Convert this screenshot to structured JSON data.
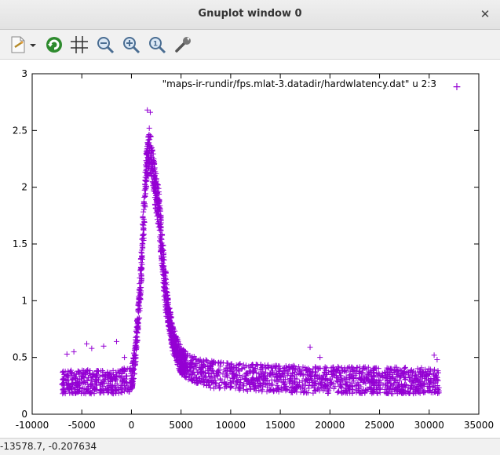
{
  "window": {
    "title": "Gnuplot window 0",
    "close_glyph": "✕"
  },
  "toolbar": {
    "items": [
      {
        "name": "export-icon",
        "tooltip": ""
      },
      {
        "name": "dropdown-arrow-icon",
        "tooltip": ""
      },
      {
        "name": "replot-icon",
        "tooltip": ""
      },
      {
        "name": "grid-icon",
        "tooltip": ""
      },
      {
        "name": "zoom-out-icon",
        "tooltip": ""
      },
      {
        "name": "zoom-in-icon",
        "tooltip": ""
      },
      {
        "name": "zoom-reset-icon",
        "tooltip": ""
      },
      {
        "name": "settings-wrench-icon",
        "tooltip": ""
      }
    ]
  },
  "status": {
    "coords": "-13578.7, -0.207634"
  },
  "colors": {
    "series": "#9400d3",
    "axis": "#000000"
  },
  "chart_data": {
    "type": "scatter",
    "title": "",
    "xlabel": "",
    "ylabel": "",
    "xlim": [
      -10000,
      35000
    ],
    "ylim": [
      0,
      3
    ],
    "x_ticks": [
      "-10000",
      "-5000",
      "0",
      "5000",
      "10000",
      "15000",
      "20000",
      "25000",
      "30000",
      "35000"
    ],
    "y_ticks": [
      "0",
      "0.5",
      "1",
      "1.5",
      "2",
      "2.5",
      "3"
    ],
    "x_tick_values": [
      -10000,
      -5000,
      0,
      5000,
      10000,
      15000,
      20000,
      25000,
      30000,
      35000
    ],
    "y_tick_values": [
      0,
      0.5,
      1,
      1.5,
      2,
      2.5,
      3
    ],
    "grid": false,
    "legend_position": "top-right",
    "series": [
      {
        "name": "\"maps-ir-rundir/fps.mlat-3.datadir/hardwlatency.dat\" u 2:3",
        "marker": "+",
        "x_range": [
          -7000,
          31000
        ],
        "profile": [
          [
            -7000,
            0.27
          ],
          [
            -5000,
            0.27
          ],
          [
            -2000,
            0.27
          ],
          [
            0,
            0.3
          ],
          [
            300,
            0.45
          ],
          [
            600,
            0.75
          ],
          [
            900,
            1.15
          ],
          [
            1200,
            1.65
          ],
          [
            1500,
            2.15
          ],
          [
            1800,
            2.35
          ],
          [
            2100,
            2.2
          ],
          [
            2400,
            2.0
          ],
          [
            2700,
            1.85
          ],
          [
            3000,
            1.55
          ],
          [
            3300,
            1.2
          ],
          [
            3700,
            0.9
          ],
          [
            4200,
            0.65
          ],
          [
            5000,
            0.47
          ],
          [
            6000,
            0.4
          ],
          [
            8000,
            0.35
          ],
          [
            12000,
            0.32
          ],
          [
            20000,
            0.3
          ],
          [
            31000,
            0.29
          ]
        ],
        "peak": [
          1800,
          2.68
        ],
        "sample_points": [
          [
            -6500,
            0.53
          ],
          [
            -5800,
            0.55
          ],
          [
            -4500,
            0.62
          ],
          [
            -4000,
            0.58
          ],
          [
            -2800,
            0.6
          ],
          [
            -1500,
            0.64
          ],
          [
            -700,
            0.5
          ],
          [
            1600,
            2.68
          ],
          [
            1900,
            2.66
          ],
          [
            1700,
            2.45
          ],
          [
            2000,
            2.35
          ],
          [
            2300,
            2.1
          ],
          [
            2600,
            1.9
          ],
          [
            18000,
            0.59
          ],
          [
            19000,
            0.5
          ],
          [
            30500,
            0.52
          ],
          [
            30800,
            0.48
          ]
        ]
      }
    ]
  }
}
